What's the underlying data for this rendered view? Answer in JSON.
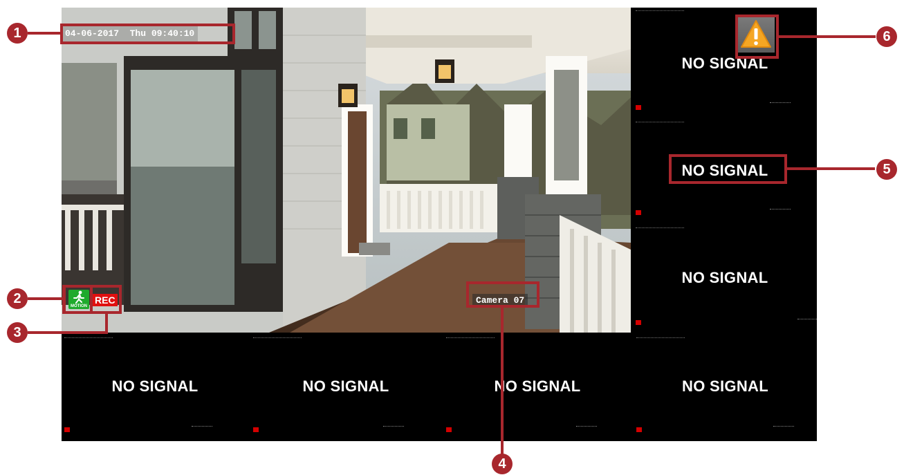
{
  "main_feed": {
    "timestamp": "04-06-2017  Thu 09:40:10",
    "camera_label": "Camera 07",
    "motion_label": "MOTION",
    "rec_label": "REC"
  },
  "tiles": {
    "no_signal": "NO SIGNAL",
    "mini_rec": "REC"
  },
  "callouts": [
    "1",
    "2",
    "3",
    "4",
    "5",
    "6"
  ],
  "icons": {
    "motion": "running-person-icon",
    "warning": "warning-triangle-icon"
  },
  "colors": {
    "callout": "#a8272d",
    "rec": "#e01010",
    "motion": "#1faa2c",
    "warning": "#f5a623"
  }
}
